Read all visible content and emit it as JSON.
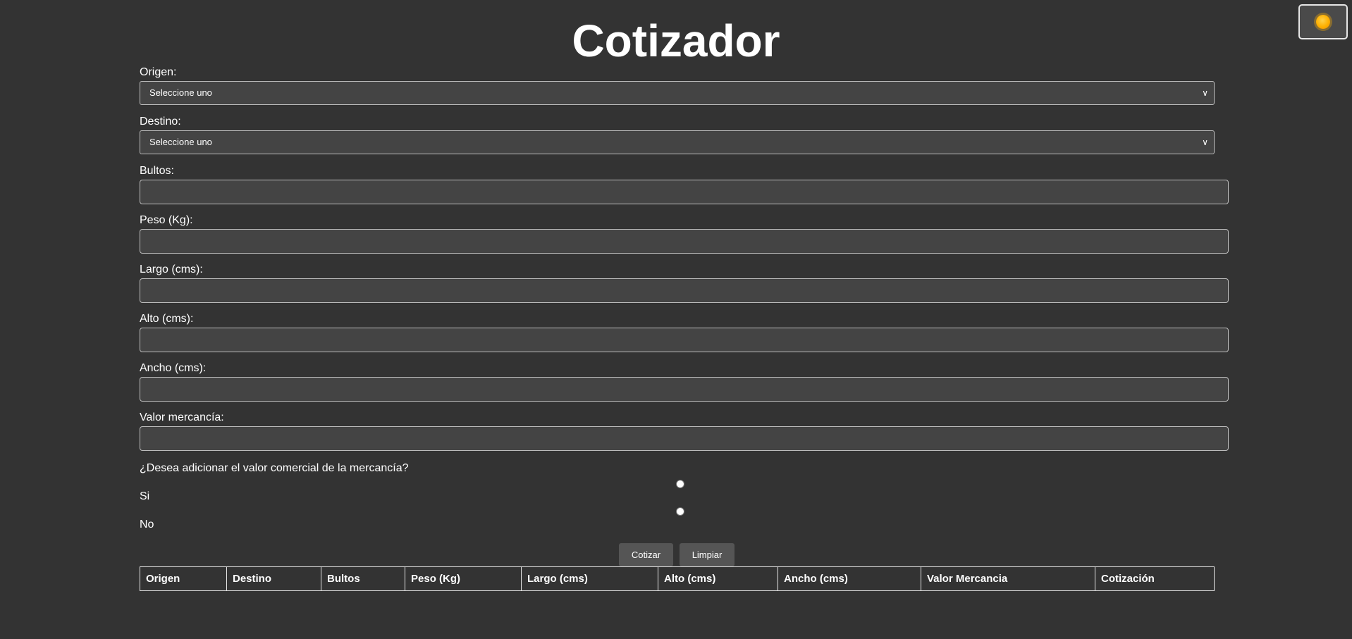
{
  "title": "Cotizador",
  "theme_toggle": {
    "icon": "sun-icon"
  },
  "form": {
    "origen": {
      "label": "Origen:",
      "value": "Seleccione uno"
    },
    "destino": {
      "label": "Destino:",
      "value": "Seleccione uno"
    },
    "bultos": {
      "label": "Bultos:",
      "value": ""
    },
    "peso": {
      "label": "Peso (Kg):",
      "value": ""
    },
    "largo": {
      "label": "Largo (cms):",
      "value": ""
    },
    "alto": {
      "label": "Alto (cms):",
      "value": ""
    },
    "ancho": {
      "label": "Ancho (cms):",
      "value": ""
    },
    "valor": {
      "label": "Valor mercancía:",
      "value": ""
    }
  },
  "question": "¿Desea adicionar el valor comercial de la mercancía?",
  "options": {
    "si": "Si",
    "no": "No"
  },
  "buttons": {
    "cotizar": "Cotizar",
    "limpiar": "Limpiar"
  },
  "table": {
    "headers": [
      "Origen",
      "Destino",
      "Bultos",
      "Peso (Kg)",
      "Largo (cms)",
      "Alto (cms)",
      "Ancho (cms)",
      "Valor Mercancia",
      "Cotización"
    ]
  }
}
